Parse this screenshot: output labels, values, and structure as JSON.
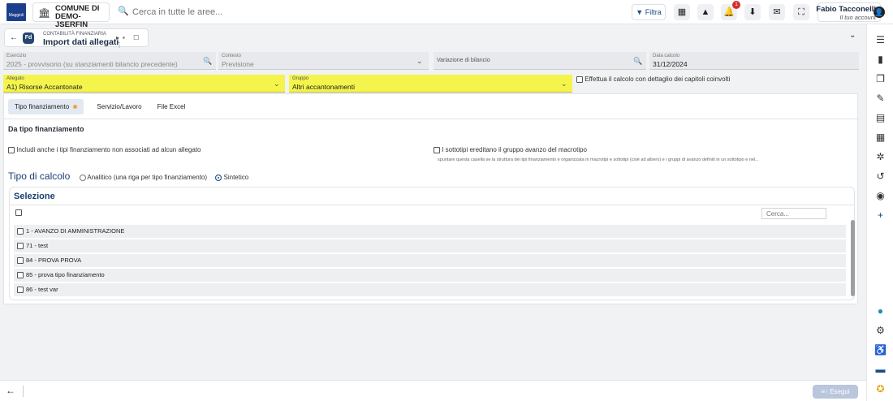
{
  "topbar": {
    "logo_text": "Maggioli",
    "comune_line1": "COMUNE DI",
    "comune_line2": "DEMO-JSERFIN",
    "search_placeholder": "Cerca in tutte le aree...",
    "filter_label": "Filtra",
    "notification_count": "1",
    "user_name": "Fabio Tacconelli",
    "user_sub": "Il tuo account"
  },
  "breadcrumb": {
    "module": "CONTABILITÀ FINANZIARIA",
    "page": "Import dati allegati",
    "badge": "Fd"
  },
  "fields": {
    "esercizio": {
      "label": "Esercizio",
      "value": "2025 - provvisorio (su stanziamenti bilancio precedente)"
    },
    "contesto": {
      "label": "Contesto",
      "value": "Previsione"
    },
    "variazione": {
      "label": "",
      "value": "Variazione di bilancio"
    },
    "data_calcolo": {
      "label": "Data calcolo",
      "value": "31/12/2024"
    },
    "allegato": {
      "label": "Allegato",
      "value": "A1) Risorse Accantonate"
    },
    "gruppo": {
      "label": "Gruppo",
      "value": "Altri accantonamenti"
    },
    "dettaglio_label": "Effettua il calcolo con dettaglio dei capitoli coinvolti"
  },
  "tabs": [
    {
      "label": "Tipo finanziamento"
    },
    {
      "label": "Servizio/Lavoro"
    },
    {
      "label": "File Excel"
    }
  ],
  "section": {
    "title": "Da tipo finanziamento",
    "includi_label": "Includi anche i tipi finanziamento non associati ad alcun allegato",
    "sottotipi_label": "I sottotipi ereditano il gruppo avanzo del macrotipo",
    "sottotipi_hint": "spuntare questa casella se la struttura dei tipi finanziamento è organizzata in macrotipi e sottotipi (cioè ad albero) e i gruppi di avanzo definiti in un sottotipo e nel...",
    "tipo_calcolo": "Tipo di calcolo",
    "radio_analitico": "Analitico (una riga per tipo finanziamento)",
    "radio_sintetico": "Sintetico"
  },
  "selezione": {
    "title": "Selezione",
    "search_placeholder": "Cerca...",
    "rows": [
      "1 - AVANZO DI AMMINISTRAZIONE",
      "71 - test",
      "84 - PROVA PROVA",
      "85 - prova tipo finanziamento",
      "86 - test var"
    ]
  },
  "footer": {
    "run_label": "Esegui"
  },
  "colors": {
    "highlight": "#f4f44c",
    "primary": "#1a3f72",
    "accent_dot": "#f0a33a"
  }
}
